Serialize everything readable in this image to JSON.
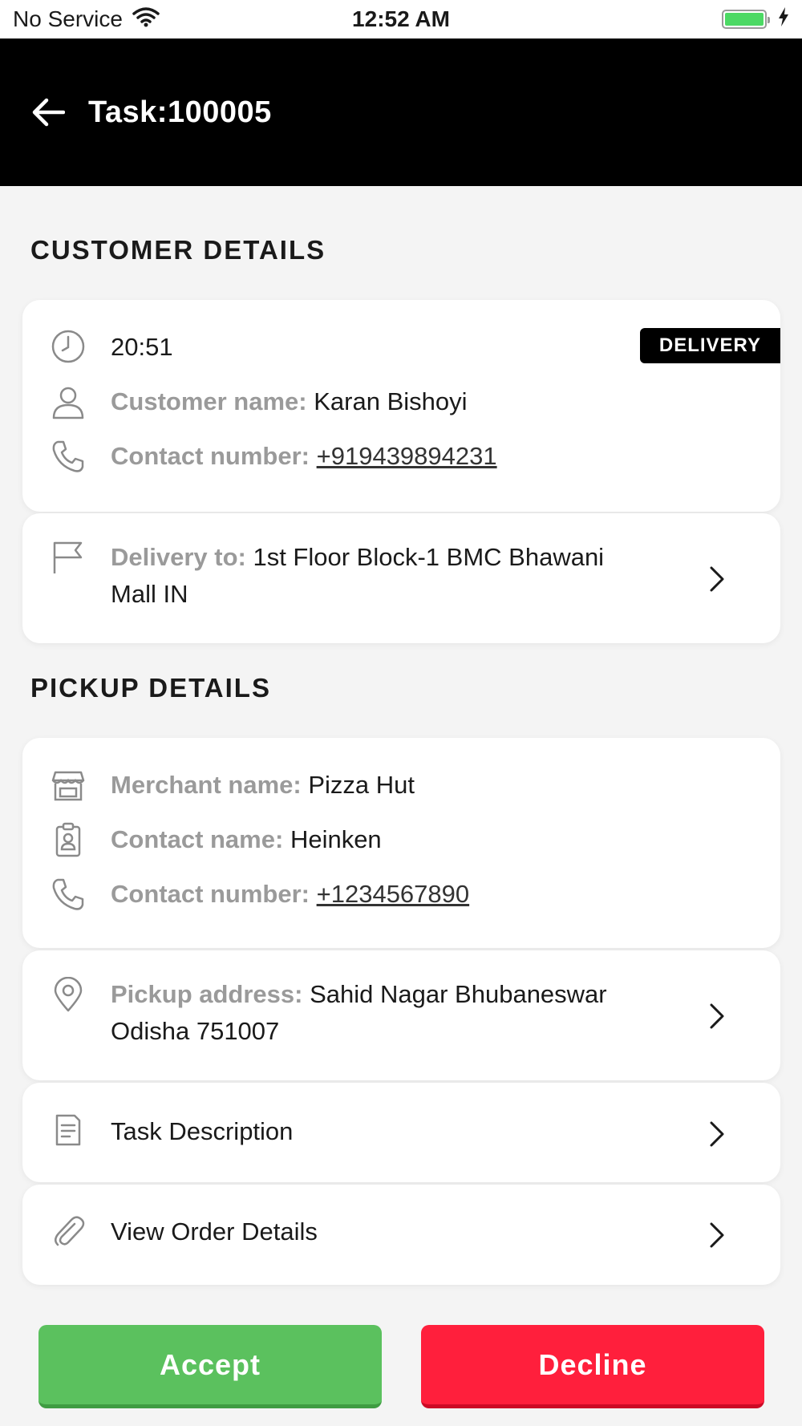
{
  "status_bar": {
    "carrier": "No Service",
    "time": "12:52 AM"
  },
  "header": {
    "title": "Task:100005",
    "background": "#000000"
  },
  "customer_section": {
    "title": "CUSTOMER DETAILS",
    "time": "20:51",
    "badge": "DELIVERY",
    "customer_name_label": "Customer name:",
    "customer_name": "Karan Bishoyi",
    "contact_number_label": "Contact number:",
    "contact_number": "+919439894231",
    "delivery_label": "Delivery to:",
    "delivery_line1": "1st Floor Block-1 BMC Bhawani",
    "delivery_line2": "Mall IN"
  },
  "pickup_section": {
    "title": "PICKUP DETAILS",
    "merchant_name_label": "Merchant name:",
    "merchant_name": "Pizza Hut",
    "contact_name_label": "Contact name:",
    "contact_name": "Heinken",
    "contact_number_label": "Contact number:",
    "contact_number": "+1234567890",
    "pickup_label": "Pickup address:",
    "pickup_line1": "Sahid Nagar Bhubaneswar",
    "pickup_line2": "Odisha 751007",
    "task_description": "Task Description",
    "view_order_details": "View Order Details"
  },
  "actions": {
    "accept_label": "Accept",
    "accept_color": "#5bc15e",
    "decline_label": "Decline",
    "decline_color": "#ff1f3c"
  },
  "icons": [
    "wifi-icon",
    "battery-icon",
    "charging-bolt-icon",
    "back-arrow-icon",
    "clock-icon",
    "user-icon",
    "phone-icon",
    "flag-icon",
    "store-icon",
    "contact-badge-icon",
    "location-pin-icon",
    "document-icon",
    "paperclip-icon",
    "chevron-right-icon"
  ]
}
